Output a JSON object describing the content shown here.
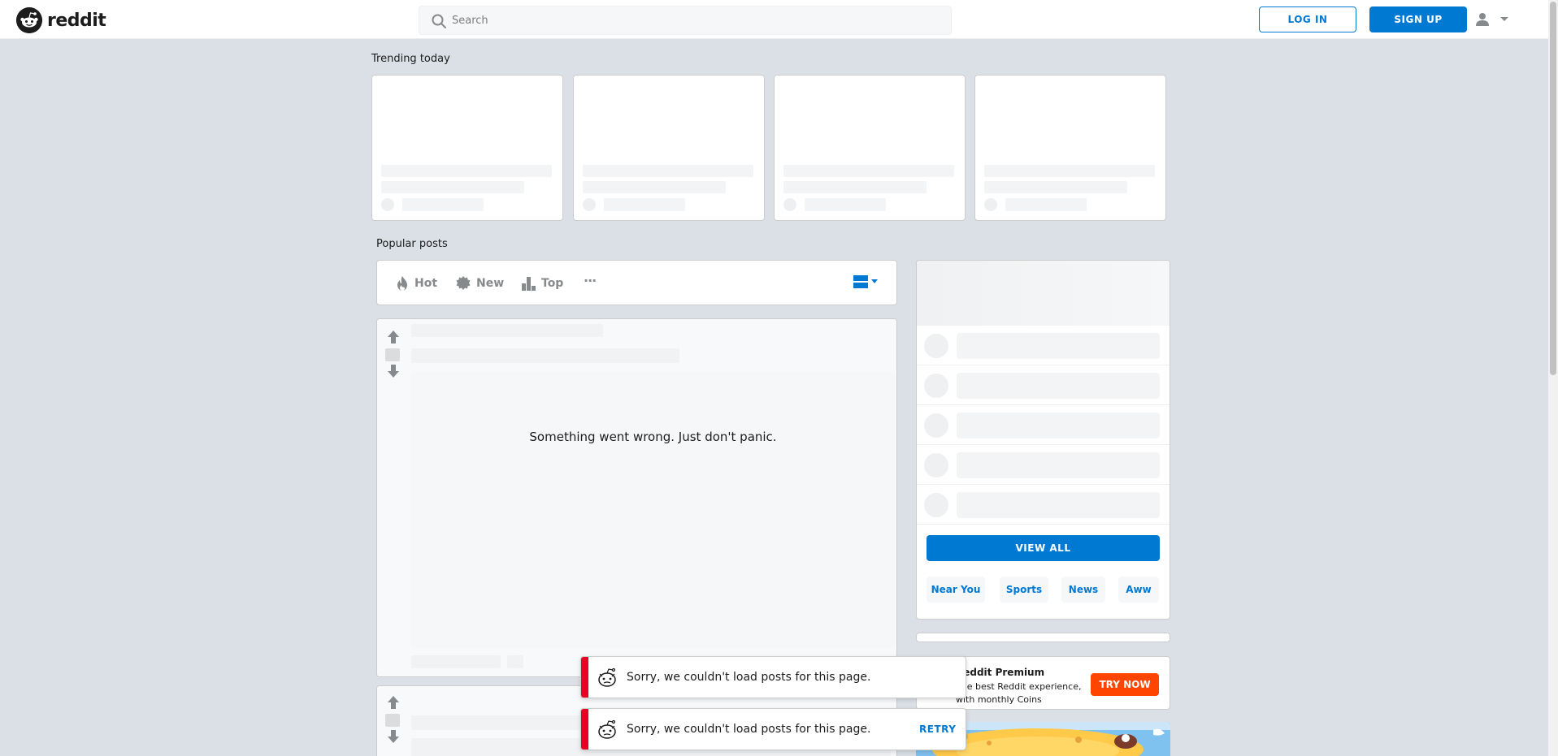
{
  "header": {
    "logo_text": "reddit",
    "search_placeholder": "Search",
    "login_label": "LOG IN",
    "signup_label": "SIGN UP"
  },
  "trending": {
    "title": "Trending today",
    "cards": [
      {},
      {},
      {},
      {}
    ]
  },
  "popular": {
    "title": "Popular posts",
    "sort_options": [
      {
        "label": "Hot",
        "icon": "flame-icon"
      },
      {
        "label": "New",
        "icon": "sparkle-badge-icon"
      },
      {
        "label": "Top",
        "icon": "bar-chart-icon"
      }
    ],
    "more_label": "···"
  },
  "feed": {
    "error_message": "Something went wrong. Just don't panic."
  },
  "sidebar": {
    "view_all_label": "VIEW ALL",
    "chips": [
      "Near You",
      "Sports",
      "News",
      "Aww"
    ]
  },
  "premium": {
    "title": "Reddit Premium",
    "subtitle": "The best Reddit experience, with monthly Coins",
    "cta_label": "TRY NOW"
  },
  "toasts": [
    {
      "message": "Sorry, we couldn't load posts for this page.",
      "action": ""
    },
    {
      "message": "Sorry, we couldn't load posts for this page.",
      "action": "RETRY"
    }
  ],
  "colors": {
    "brand_blue": "#0079d3",
    "orange": "#ff4500",
    "error_red": "#ea0027",
    "background": "#dae0e6"
  }
}
